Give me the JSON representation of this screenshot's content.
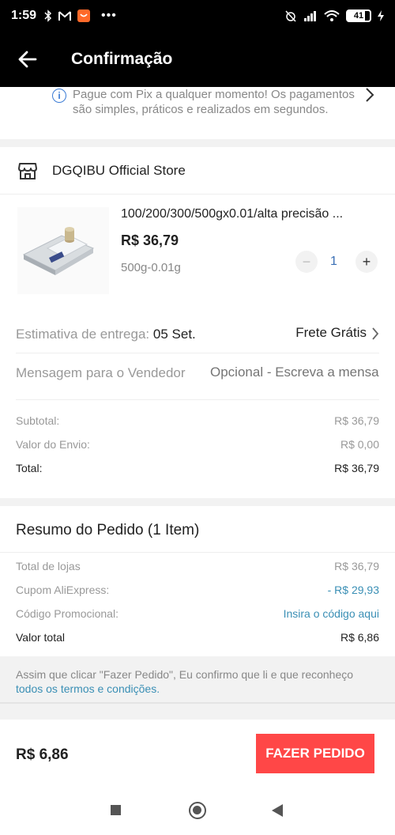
{
  "status_bar": {
    "time": "1:59",
    "battery": "41"
  },
  "app_bar": {
    "title": "Confirmação",
    "back_icon": "arrow-left-icon"
  },
  "pix_banner": {
    "text": "Pague com Pix a qualquer momento! Os pagamentos são simples, práticos e realizados em segundos."
  },
  "store": {
    "name": "DGQIBU Official Store"
  },
  "product": {
    "title": "100/200/300/500gx0.01/alta precisão ...",
    "price": "R$ 36,79",
    "variant": "500g-0.01g",
    "quantity": "1",
    "minus": "−",
    "plus": "+"
  },
  "delivery": {
    "label": "Estimativa de entrega:",
    "date": "05 Set.",
    "shipping": "Frete Grátis"
  },
  "message": {
    "label": "Mensagem para o Vendedor",
    "placeholder": "Opcional - Escreva a mensagem"
  },
  "store_totals": {
    "subtotal_label": "Subtotal:",
    "subtotal_value": "R$ 36,79",
    "shipping_label": "Valor do Envio:",
    "shipping_value": "R$ 0,00",
    "total_label": "Total:",
    "total_value": "R$ 36,79"
  },
  "order_summary": {
    "title": "Resumo do Pedido (1 Item)",
    "stores_label": "Total de lojas",
    "stores_value": "R$ 36,79",
    "coupon_label": "Cupom AliExpress:",
    "coupon_value": "- R$ 29,93",
    "promo_label": "Código Promocional:",
    "promo_link": "Insira o código aqui",
    "total_label": "Valor total",
    "total_value": "R$ 6,86"
  },
  "terms": {
    "text": "Assim que clicar \"Fazer Pedido\", Eu confirmo que li e que reconheço",
    "link": "todos os termos e condições."
  },
  "bottom_bar": {
    "total": "R$ 6,86",
    "button": "FAZER PEDIDO"
  },
  "colors": {
    "accent": "#ff4747",
    "link": "#3a8fb5",
    "header": "#000000"
  }
}
